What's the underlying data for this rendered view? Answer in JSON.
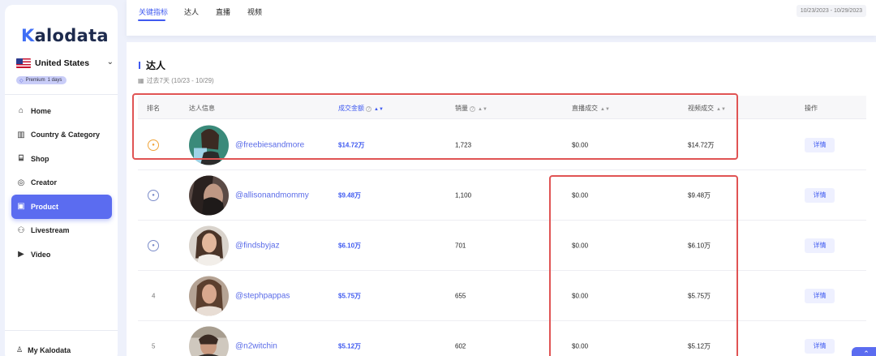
{
  "brand": {
    "k": "K",
    "rest": "alodata"
  },
  "sidebar": {
    "country": "United States",
    "premium": "Premium",
    "premium_days": "1 days",
    "items": [
      {
        "label": "Home",
        "icon": "home-icon"
      },
      {
        "label": "Country & Category",
        "icon": "bank-icon"
      },
      {
        "label": "Shop",
        "icon": "shop-icon"
      },
      {
        "label": "Creator",
        "icon": "creator-icon"
      },
      {
        "label": "Product",
        "icon": "product-icon",
        "active": true
      },
      {
        "label": "Livestream",
        "icon": "livestream-icon"
      },
      {
        "label": "Video",
        "icon": "video-icon"
      }
    ],
    "account": "My Kalodata"
  },
  "topbar": {
    "tabs": [
      "关键指标",
      "达人",
      "直播",
      "视频"
    ],
    "active_tab": 0,
    "date_range": "10/23/2023 - 10/29/2023"
  },
  "section": {
    "title": "达人",
    "subtitle": "过去7天 (10/23 - 10/29)"
  },
  "table": {
    "headers": {
      "rank": "排名",
      "info": "达人信息",
      "amount": "成交金额",
      "sales": "销量",
      "live": "直播成交",
      "video": "视频成交",
      "action": "操作"
    },
    "detail_label": "详情",
    "rows": [
      {
        "rank": "1",
        "handle": "@freebiesandmore",
        "amount": "$14.72万",
        "sales": "1,723",
        "live": "$0.00",
        "video": "$14.72万"
      },
      {
        "rank": "2",
        "handle": "@allisonandmommy",
        "amount": "$9.48万",
        "sales": "1,100",
        "live": "$0.00",
        "video": "$9.48万"
      },
      {
        "rank": "3",
        "handle": "@findsbyjaz",
        "amount": "$6.10万",
        "sales": "701",
        "live": "$0.00",
        "video": "$6.10万"
      },
      {
        "rank": "4",
        "handle": "@stephpappas",
        "amount": "$5.75万",
        "sales": "655",
        "live": "$0.00",
        "video": "$5.75万"
      },
      {
        "rank": "5",
        "handle": "@n2witchin",
        "amount": "$5.12万",
        "sales": "602",
        "live": "$0.00",
        "video": "$5.12万"
      }
    ]
  },
  "colors": {
    "accent": "#3f5af0",
    "highlight": "#e05454",
    "gold": "#f0a43a",
    "silver": "#7b8cc9"
  }
}
